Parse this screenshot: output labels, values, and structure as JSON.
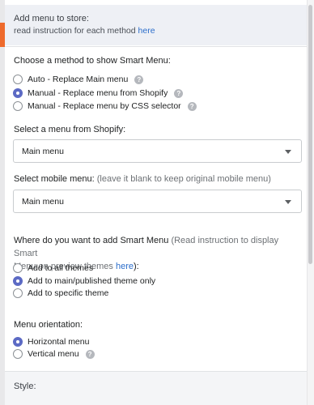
{
  "info": {
    "title": "Add menu to store:",
    "sub_prefix": "read instruction for each method ",
    "sub_link": "here"
  },
  "method": {
    "label": "Choose a method to show Smart Menu:",
    "options": [
      {
        "label": "Auto - Replace Main menu",
        "selected": false,
        "help": true
      },
      {
        "label": "Manual - Replace menu from Shopify",
        "selected": true,
        "help": true
      },
      {
        "label": "Manual - Replace menu by CSS selector",
        "selected": false,
        "help": true
      }
    ]
  },
  "shopify_menu": {
    "label": "Select a menu from Shopify:",
    "value": "Main menu"
  },
  "mobile_menu": {
    "label": "Select mobile menu:",
    "hint": " (leave it blank to keep original mobile menu)",
    "value": "Main menu"
  },
  "where": {
    "label": "Where do you want to add Smart Menu",
    "hint_line1": " (Read instruction to display Smart",
    "hint_line2": "Menu on preview themes ",
    "hint_link": "here",
    "hint_end": "):",
    "options": [
      {
        "label": "Add to all themes",
        "selected": false
      },
      {
        "label": "Add to main/published theme only",
        "selected": true
      },
      {
        "label": "Add to specific theme",
        "selected": false
      }
    ]
  },
  "orientation": {
    "label": "Menu orientation:",
    "options": [
      {
        "label": "Horizontal menu",
        "selected": true,
        "help": false
      },
      {
        "label": "Vertical menu",
        "selected": false,
        "help": true
      }
    ]
  },
  "style": {
    "label": "Style:"
  },
  "help_glyph": "?",
  "colors": {
    "accent": "#5c6ac4",
    "link": "#2c6ecb",
    "brand_strip": "#ee6a2c"
  }
}
